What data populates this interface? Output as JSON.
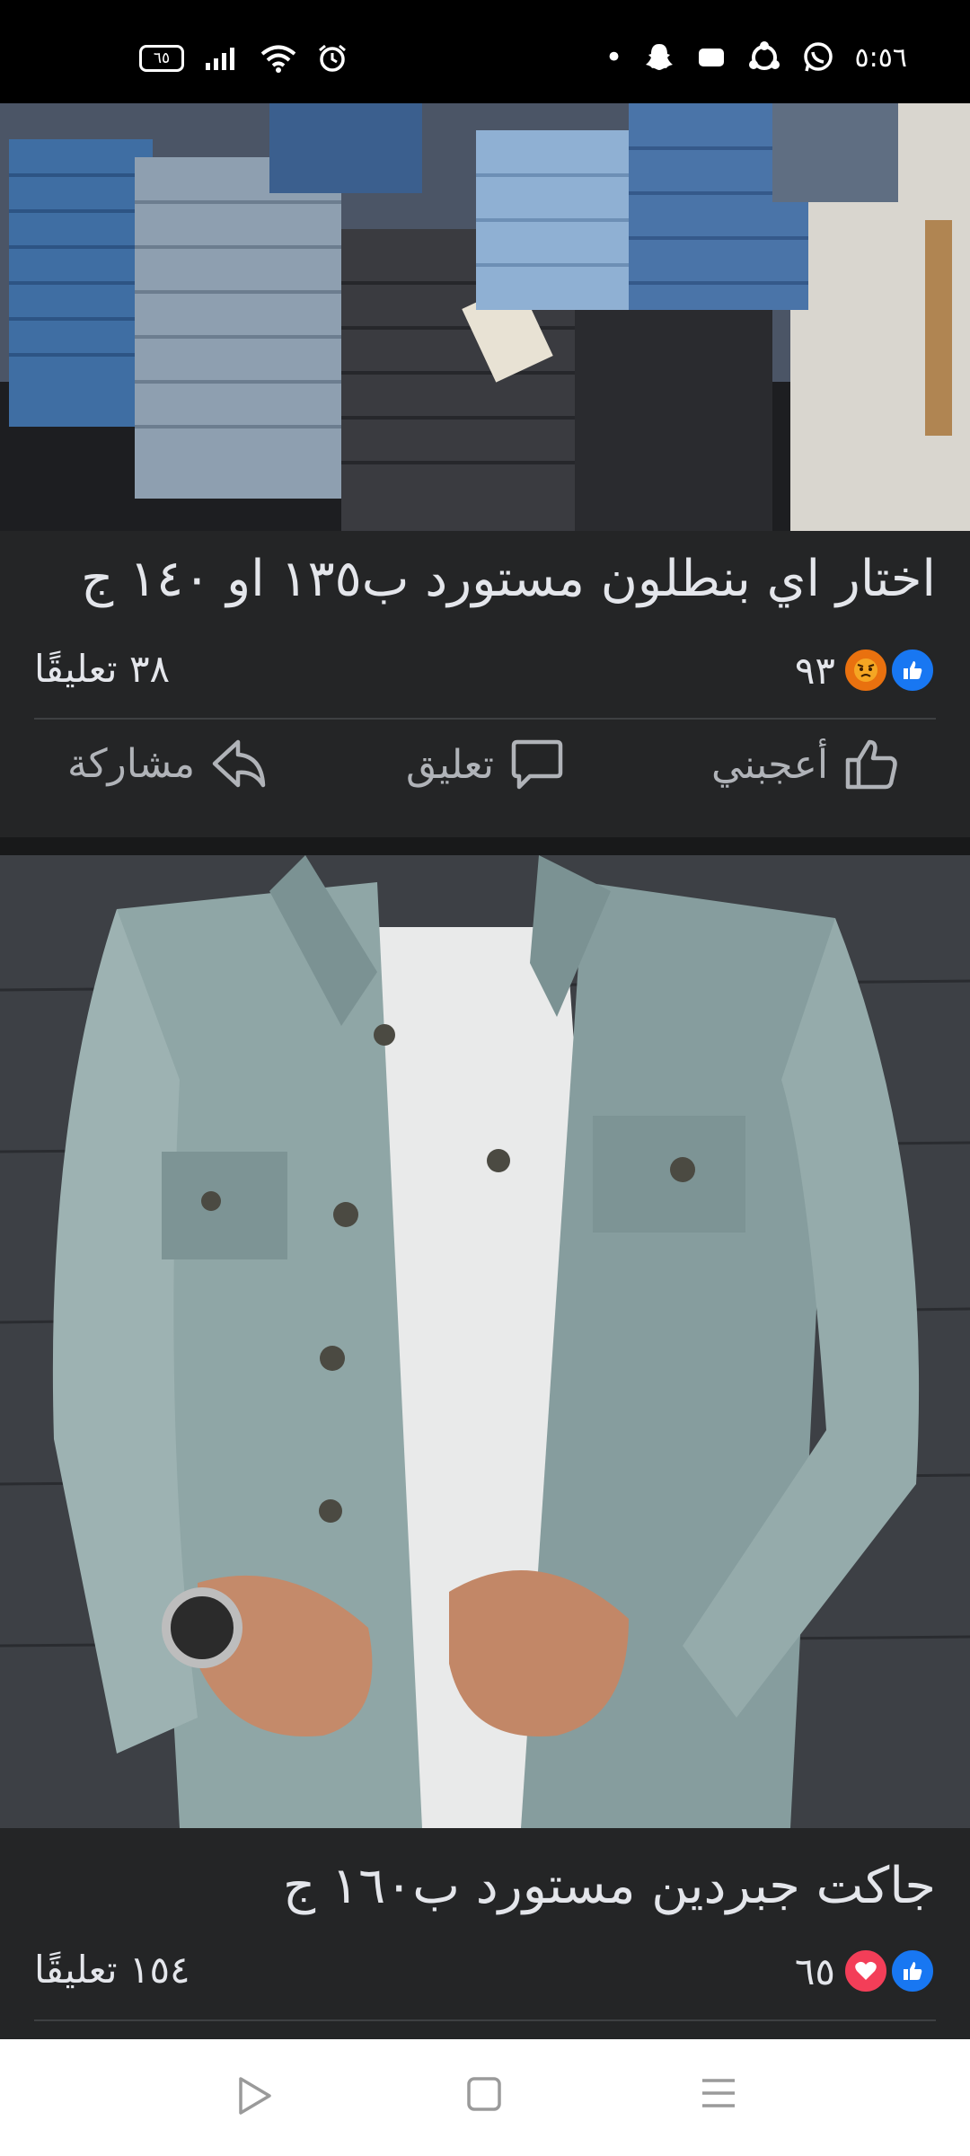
{
  "status_bar": {
    "battery": "٦٥",
    "time": "٥:٥٦",
    "dot": "•"
  },
  "posts": [
    {
      "image_alt": "jeans",
      "caption": "اختار اي بنطلون مستورد ب١٣٥ او ١٤٠ ج",
      "reaction_count": "٩٣",
      "comments": "٣٨ تعليقًا",
      "reactions": [
        "like-icon",
        "angry-icon"
      ]
    },
    {
      "image_alt": "jacket",
      "caption": "جاكت جبردين مستورد ب١٦٠ ج",
      "reaction_count": "٦٥",
      "comments": "١٥٤ تعليقًا",
      "reactions": [
        "like-icon",
        "love-icon"
      ]
    }
  ],
  "actions": {
    "like": "أعجبني",
    "comment": "تعليق",
    "share": "مشاركة"
  },
  "colors": {
    "background": "#242526",
    "like_blue": "#1877f2",
    "love_red": "#f33e58",
    "angry_orange": "#e9710f",
    "muted_text": "#b0b3b8"
  }
}
